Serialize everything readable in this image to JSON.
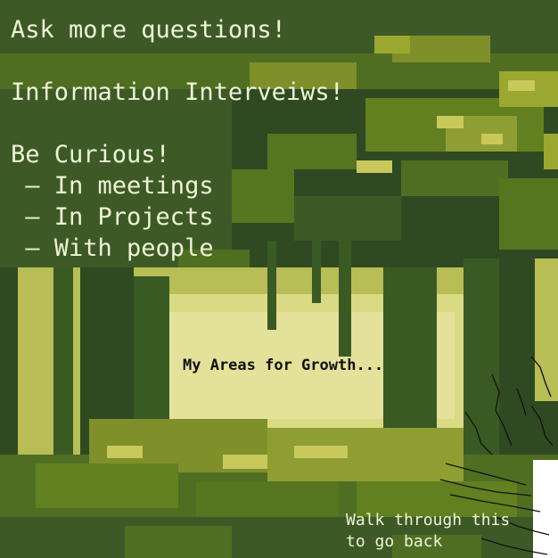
{
  "notes": {
    "line1": "Ask more questions!",
    "line2": "",
    "line3": "Information Interveiws!",
    "line4": "",
    "line5": "Be Curious!",
    "line6": " – In meetings",
    "line7": " – In Projects",
    "line8": " – With people"
  },
  "scene": {
    "title": "My Areas for Growth...",
    "exit_line1": "Walk through this",
    "exit_line2": "to go back"
  },
  "colors": {
    "dark_leaf": "#2f4a22",
    "mid_leaf": "#55751f",
    "light_leaf": "#9aa830",
    "glow": "#d9da83",
    "pale": "#ebe8a4",
    "text": "#eef3d8"
  }
}
